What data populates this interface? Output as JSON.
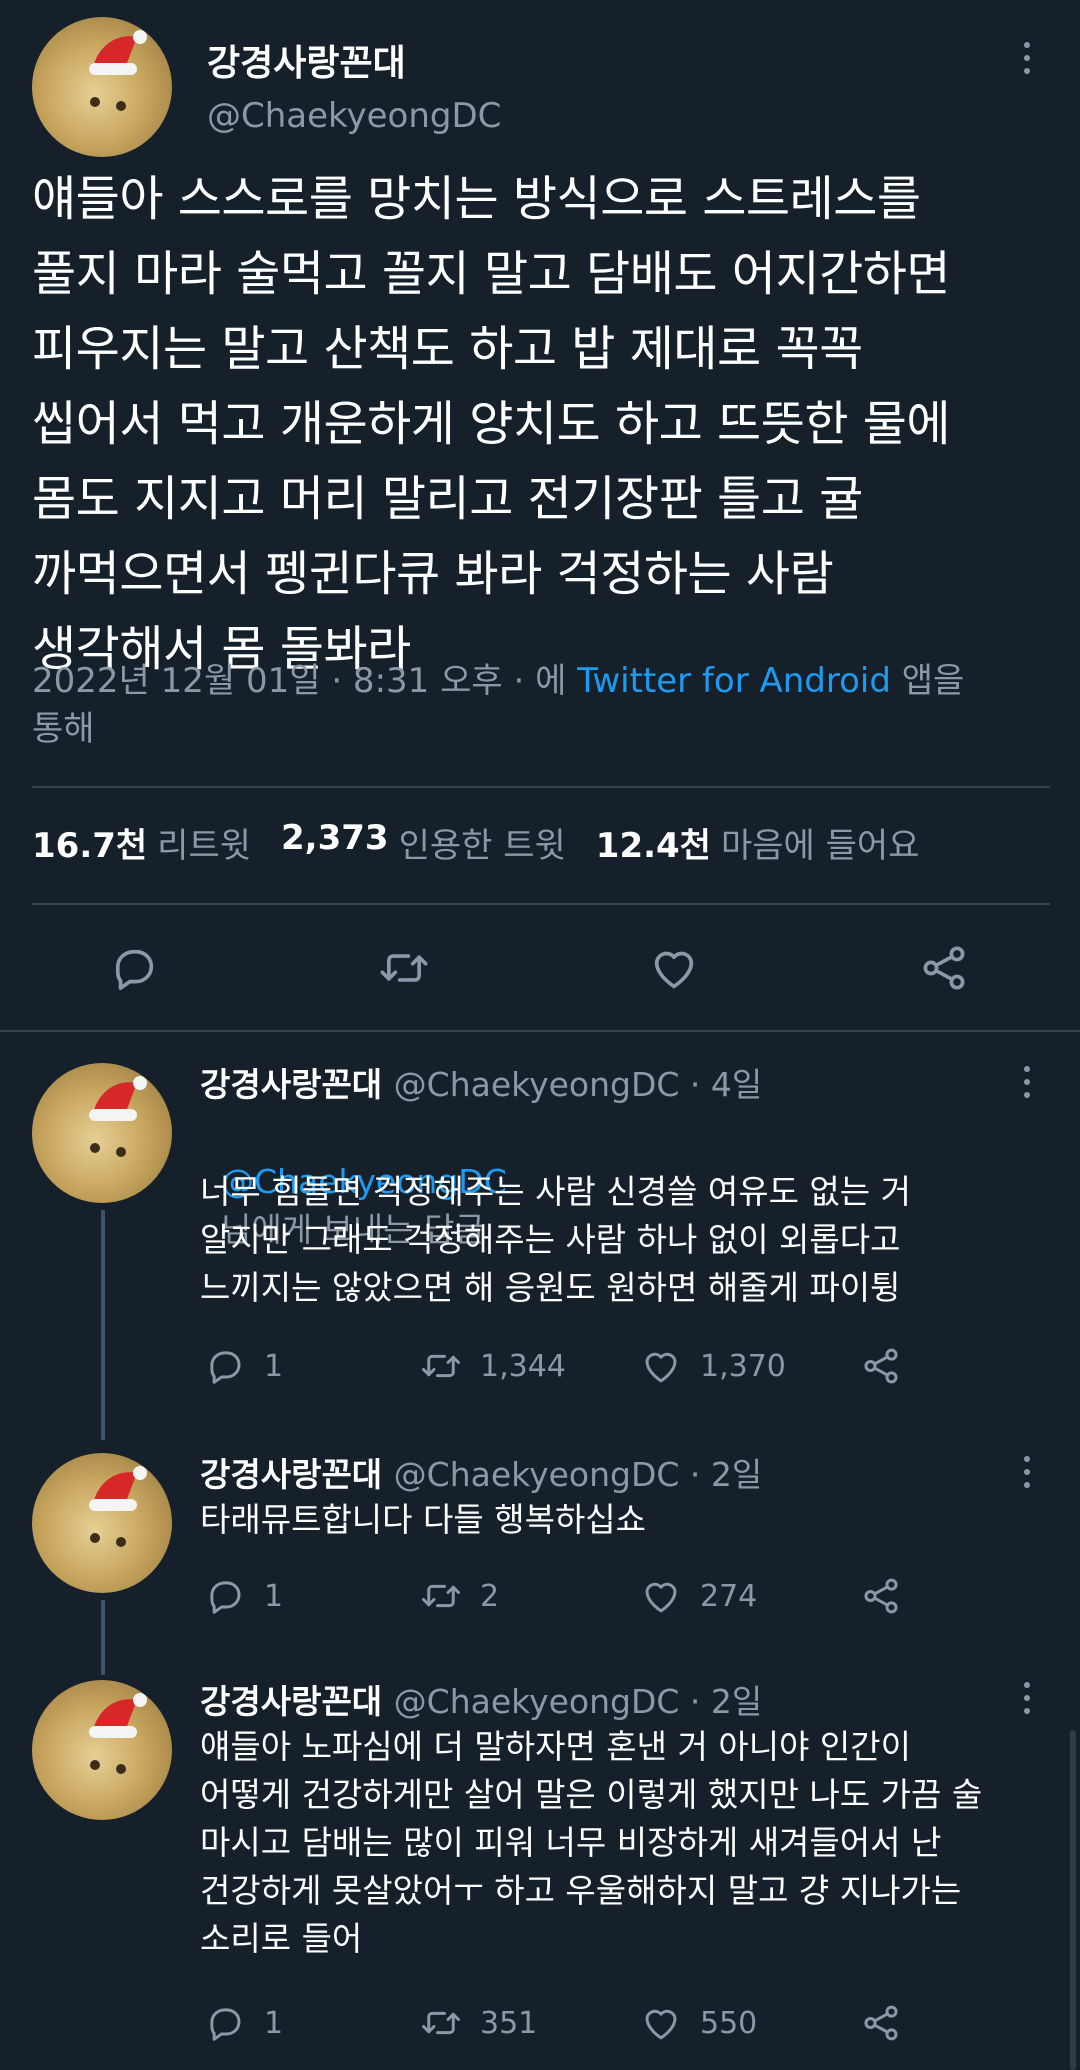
{
  "main_tweet": {
    "name": "강경사랑꼰대",
    "handle": "@ChaekyeongDC",
    "text": "얘들아 스스로를 망치는 방식으로 스트레스를\n풀지 마라 술먹고 꼴지 말고 담배도 어지간하면\n피우지는 말고 산책도 하고 밥 제대로 꼭꼭\n씹어서 먹고 개운하게 양치도 하고 뜨뜻한 물에\n몸도 지지고 머리 말리고 전기장판 틀고 귤\n까먹으면서 펭귄다큐 봐라 걱정하는 사람\n생각해서 몸 돌봐라",
    "timestamp": "2022년 12월 01일 · 8:31 오후 · 에",
    "client": "Twitter for Android",
    "client_suffix": "앱을",
    "meta_line2": "통해",
    "stats": {
      "retweets_num": "16.7천",
      "retweets_label": "리트윗",
      "quotes_num": "2,373",
      "quotes_label": "인용한 트윗",
      "likes_num": "12.4천",
      "likes_label": "마음에 들어요"
    },
    "actions": [
      "reply-icon",
      "retweet-icon",
      "like-icon",
      "share-icon"
    ]
  },
  "replies": [
    {
      "name": "강경사랑꼰대",
      "handle": "@ChaekyeongDC · 4일",
      "reply_to_handle": "@ChaekyeongDC",
      "reply_to_suffix": "님에게 보내는 답글",
      "text": "너무 힘들면 걱정해주는 사람 신경쓸 여유도 없는 거\n알지만 그래도 걱정해주는 사람 하나 없이 외롭다고\n느끼지는 않았으면 해 응원도 원하면 해줄게 파이튕",
      "replies": "1",
      "retweets": "1,344",
      "likes": "1,370"
    },
    {
      "name": "강경사랑꼰대",
      "handle": "@ChaekyeongDC · 2일",
      "text": "타래뮤트합니다 다들 행복하십쇼",
      "replies": "1",
      "retweets": "2",
      "likes": "274"
    },
    {
      "name": "강경사랑꼰대",
      "handle": "@ChaekyeongDC · 2일",
      "text": "얘들아 노파심에 더 말하자면 혼낸 거 아니야 인간이\n어떻게 건강하게만 살어 말은 이렇게 했지만 나도 가끔 술\n마시고 담배는 많이 피워 너무 비장하게 새겨들어서 난\n건강하게 못살았어ㅜ 하고 우울해하지 말고 걍 지나가는\n소리로 들어",
      "replies": "1",
      "retweets": "351",
      "likes": "550"
    }
  ],
  "colors": {
    "background": "#15202b",
    "text_primary": "#ffffff",
    "text_secondary": "#8b98a5",
    "accent": "#1d9bf0",
    "divider": "#38444d"
  }
}
